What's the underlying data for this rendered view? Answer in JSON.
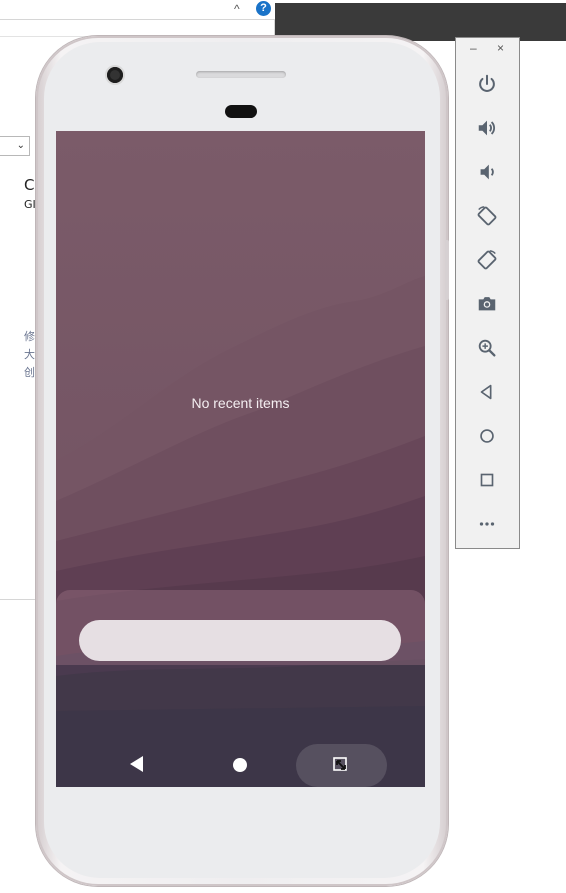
{
  "background_window": {
    "help_glyph": "?",
    "caret_glyph": "^",
    "select_chevron": "⌄",
    "text_lines": [
      "C",
      "GI",
      "修",
      "大",
      "创"
    ]
  },
  "screen": {
    "recents_empty_text": "No recent items",
    "nav": {
      "back_icon": "back-triangle-icon",
      "home_icon": "home-circle-icon",
      "recents_icon": "resize-arrows-icon"
    }
  },
  "toolbar": {
    "minimize_label": "–",
    "close_label": "×",
    "buttons": [
      {
        "name": "power-icon"
      },
      {
        "name": "volume-up-icon"
      },
      {
        "name": "volume-down-icon"
      },
      {
        "name": "rotate-left-icon"
      },
      {
        "name": "rotate-right-icon"
      },
      {
        "name": "camera-icon"
      },
      {
        "name": "zoom-icon"
      },
      {
        "name": "back-icon"
      },
      {
        "name": "home-icon"
      },
      {
        "name": "overview-icon"
      },
      {
        "name": "more-icon"
      }
    ]
  },
  "colors": {
    "wallpaper_top": "#7a5a68",
    "wallpaper_bottom": "#3d3648",
    "toolbar_icon": "#5a6470",
    "help_badge": "#1a73c8"
  }
}
